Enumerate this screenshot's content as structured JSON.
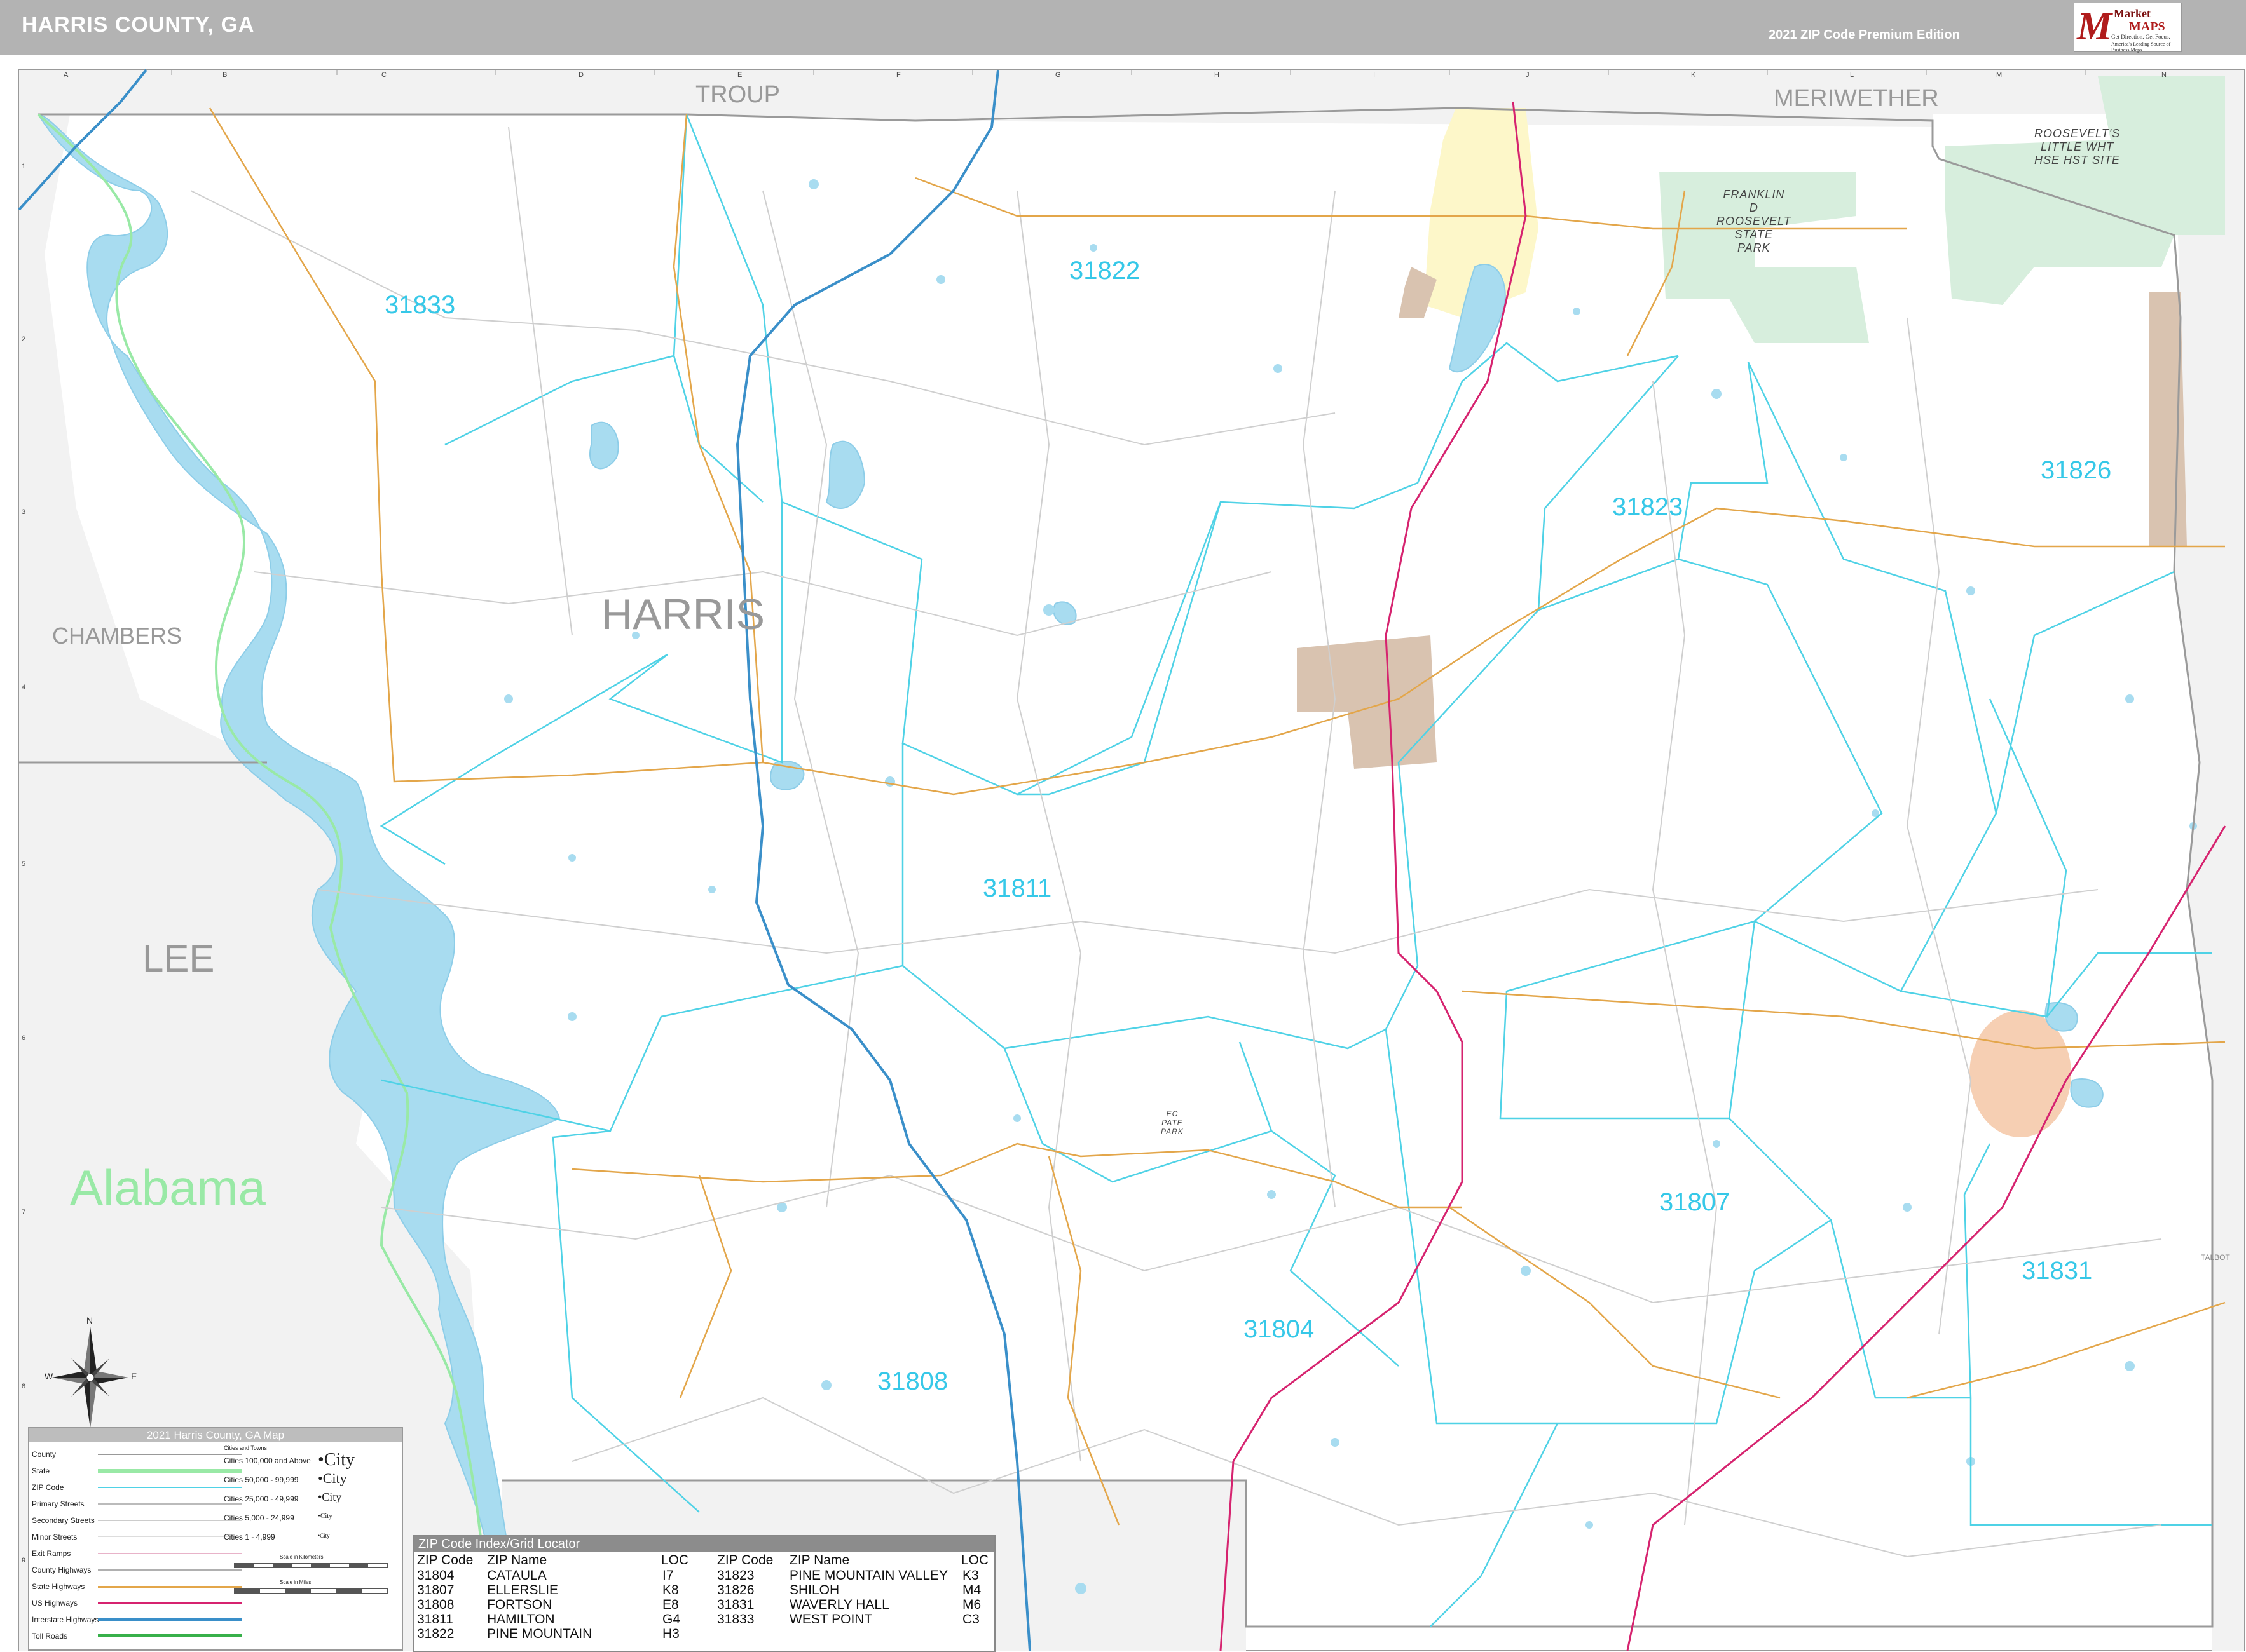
{
  "header": {
    "title": "HARRIS COUNTY, GA",
    "edition": "2021 ZIP Code Premium Edition",
    "logo": {
      "brand_top": "Market",
      "brand_bottom": "MAPS",
      "tagline1": "Get Direction. Get Focus.",
      "tagline2": "America's Leading Source of Business Maps"
    }
  },
  "colors": {
    "header_bg": "#b3b3b3",
    "zip_label": "#36c8e8",
    "zip_boundary": "#4fd2e6",
    "water": "#a8dcf0",
    "park": "#d7eedd",
    "city": "#d9c3b0",
    "state_line": "#99e9a6",
    "interstate": "#3a8fc9",
    "us_highway": "#d6236f",
    "state_highway": "#e3a64a",
    "outside_county": "#f2f2f2"
  },
  "map": {
    "counties": [
      {
        "name": "TROUP"
      },
      {
        "name": "MERIWETHER"
      },
      {
        "name": "CHAMBERS"
      },
      {
        "name": "HARRIS"
      },
      {
        "name": "LEE"
      }
    ],
    "state_label": "Alabama",
    "zip_labels": [
      {
        "zip": "31833"
      },
      {
        "zip": "31822"
      },
      {
        "zip": "31823"
      },
      {
        "zip": "31826"
      },
      {
        "zip": "31811"
      },
      {
        "zip": "31807"
      },
      {
        "zip": "31831"
      },
      {
        "zip": "31804"
      },
      {
        "zip": "31808"
      }
    ],
    "parks": [
      {
        "name": "FRANKLIN\nD\nROOSEVELT\nSTATE\nPARK"
      },
      {
        "name": "ROOSEVELT'S\nLITTLE WHT\nHSE HST SITE"
      },
      {
        "name": "EC\nPATE\nPARK"
      }
    ],
    "grid_columns": [
      "A",
      "B",
      "C",
      "D",
      "E",
      "F",
      "G",
      "H",
      "I",
      "J",
      "K",
      "L",
      "M",
      "N"
    ],
    "grid_rows": [
      "1",
      "2",
      "3",
      "4",
      "5",
      "6",
      "7",
      "8",
      "9"
    ],
    "side_label": "TALBOT"
  },
  "legend": {
    "title": "2021 Harris County, GA Map",
    "items": [
      {
        "label": "County",
        "color": "#999999",
        "style": "solid"
      },
      {
        "label": "State",
        "color": "#99e9a6",
        "style": "thick"
      },
      {
        "label": "ZIP Code",
        "color": "#4fd2e6",
        "style": "solid"
      },
      {
        "label": "Primary Streets",
        "color": "#bbbbbb",
        "style": "solid"
      },
      {
        "label": "Secondary Streets",
        "color": "#cccccc",
        "style": "solid"
      },
      {
        "label": "Minor Streets",
        "color": "#dddddd",
        "style": "solid"
      },
      {
        "label": "Exit Ramps",
        "color": "#e8b3c9",
        "style": "solid"
      },
      {
        "label": "County Highways",
        "color": "#b0b0b0",
        "style": "solid"
      },
      {
        "label": "State Highways",
        "color": "#e3a64a",
        "style": "solid"
      },
      {
        "label": "US Highways",
        "color": "#d6236f",
        "style": "solid"
      },
      {
        "label": "Interstate Highways",
        "color": "#3a8fc9",
        "style": "thick"
      },
      {
        "label": "Toll Roads",
        "color": "#38b04a",
        "style": "thick"
      }
    ],
    "cities_title": "Cities and Towns",
    "cities": [
      {
        "label": "Cities 100,000 and Above",
        "sample": "•City"
      },
      {
        "label": "Cities 50,000 - 99,999",
        "sample": "•City"
      },
      {
        "label": "Cities 25,000 - 49,999",
        "sample": "•City"
      },
      {
        "label": "Cities 5,000 - 24,999",
        "sample": "•City"
      },
      {
        "label": "Cities 1 - 4,999",
        "sample": "•City"
      }
    ],
    "scale_km": "Scale in Kilometers",
    "scale_mi": "Scale in Miles"
  },
  "zip_index": {
    "title": "ZIP Code Index/Grid Locator",
    "headers": [
      "ZIP Code",
      "ZIP Name",
      "LOC",
      "ZIP Code",
      "ZIP Name",
      "LOC"
    ],
    "left": [
      {
        "zip": "31804",
        "name": "CATAULA",
        "loc": "I7"
      },
      {
        "zip": "31807",
        "name": "ELLERSLIE",
        "loc": "K8"
      },
      {
        "zip": "31808",
        "name": "FORTSON",
        "loc": "E8"
      },
      {
        "zip": "31811",
        "name": "HAMILTON",
        "loc": "G4"
      },
      {
        "zip": "31822",
        "name": "PINE MOUNTAIN",
        "loc": "H3"
      }
    ],
    "right": [
      {
        "zip": "31823",
        "name": "PINE MOUNTAIN VALLEY",
        "loc": "K3"
      },
      {
        "zip": "31826",
        "name": "SHILOH",
        "loc": "M4"
      },
      {
        "zip": "31831",
        "name": "WAVERLY HALL",
        "loc": "M6"
      },
      {
        "zip": "31833",
        "name": "WEST POINT",
        "loc": "C3"
      }
    ]
  },
  "compass": {
    "n": "N",
    "s": "S",
    "e": "E",
    "w": "W"
  }
}
